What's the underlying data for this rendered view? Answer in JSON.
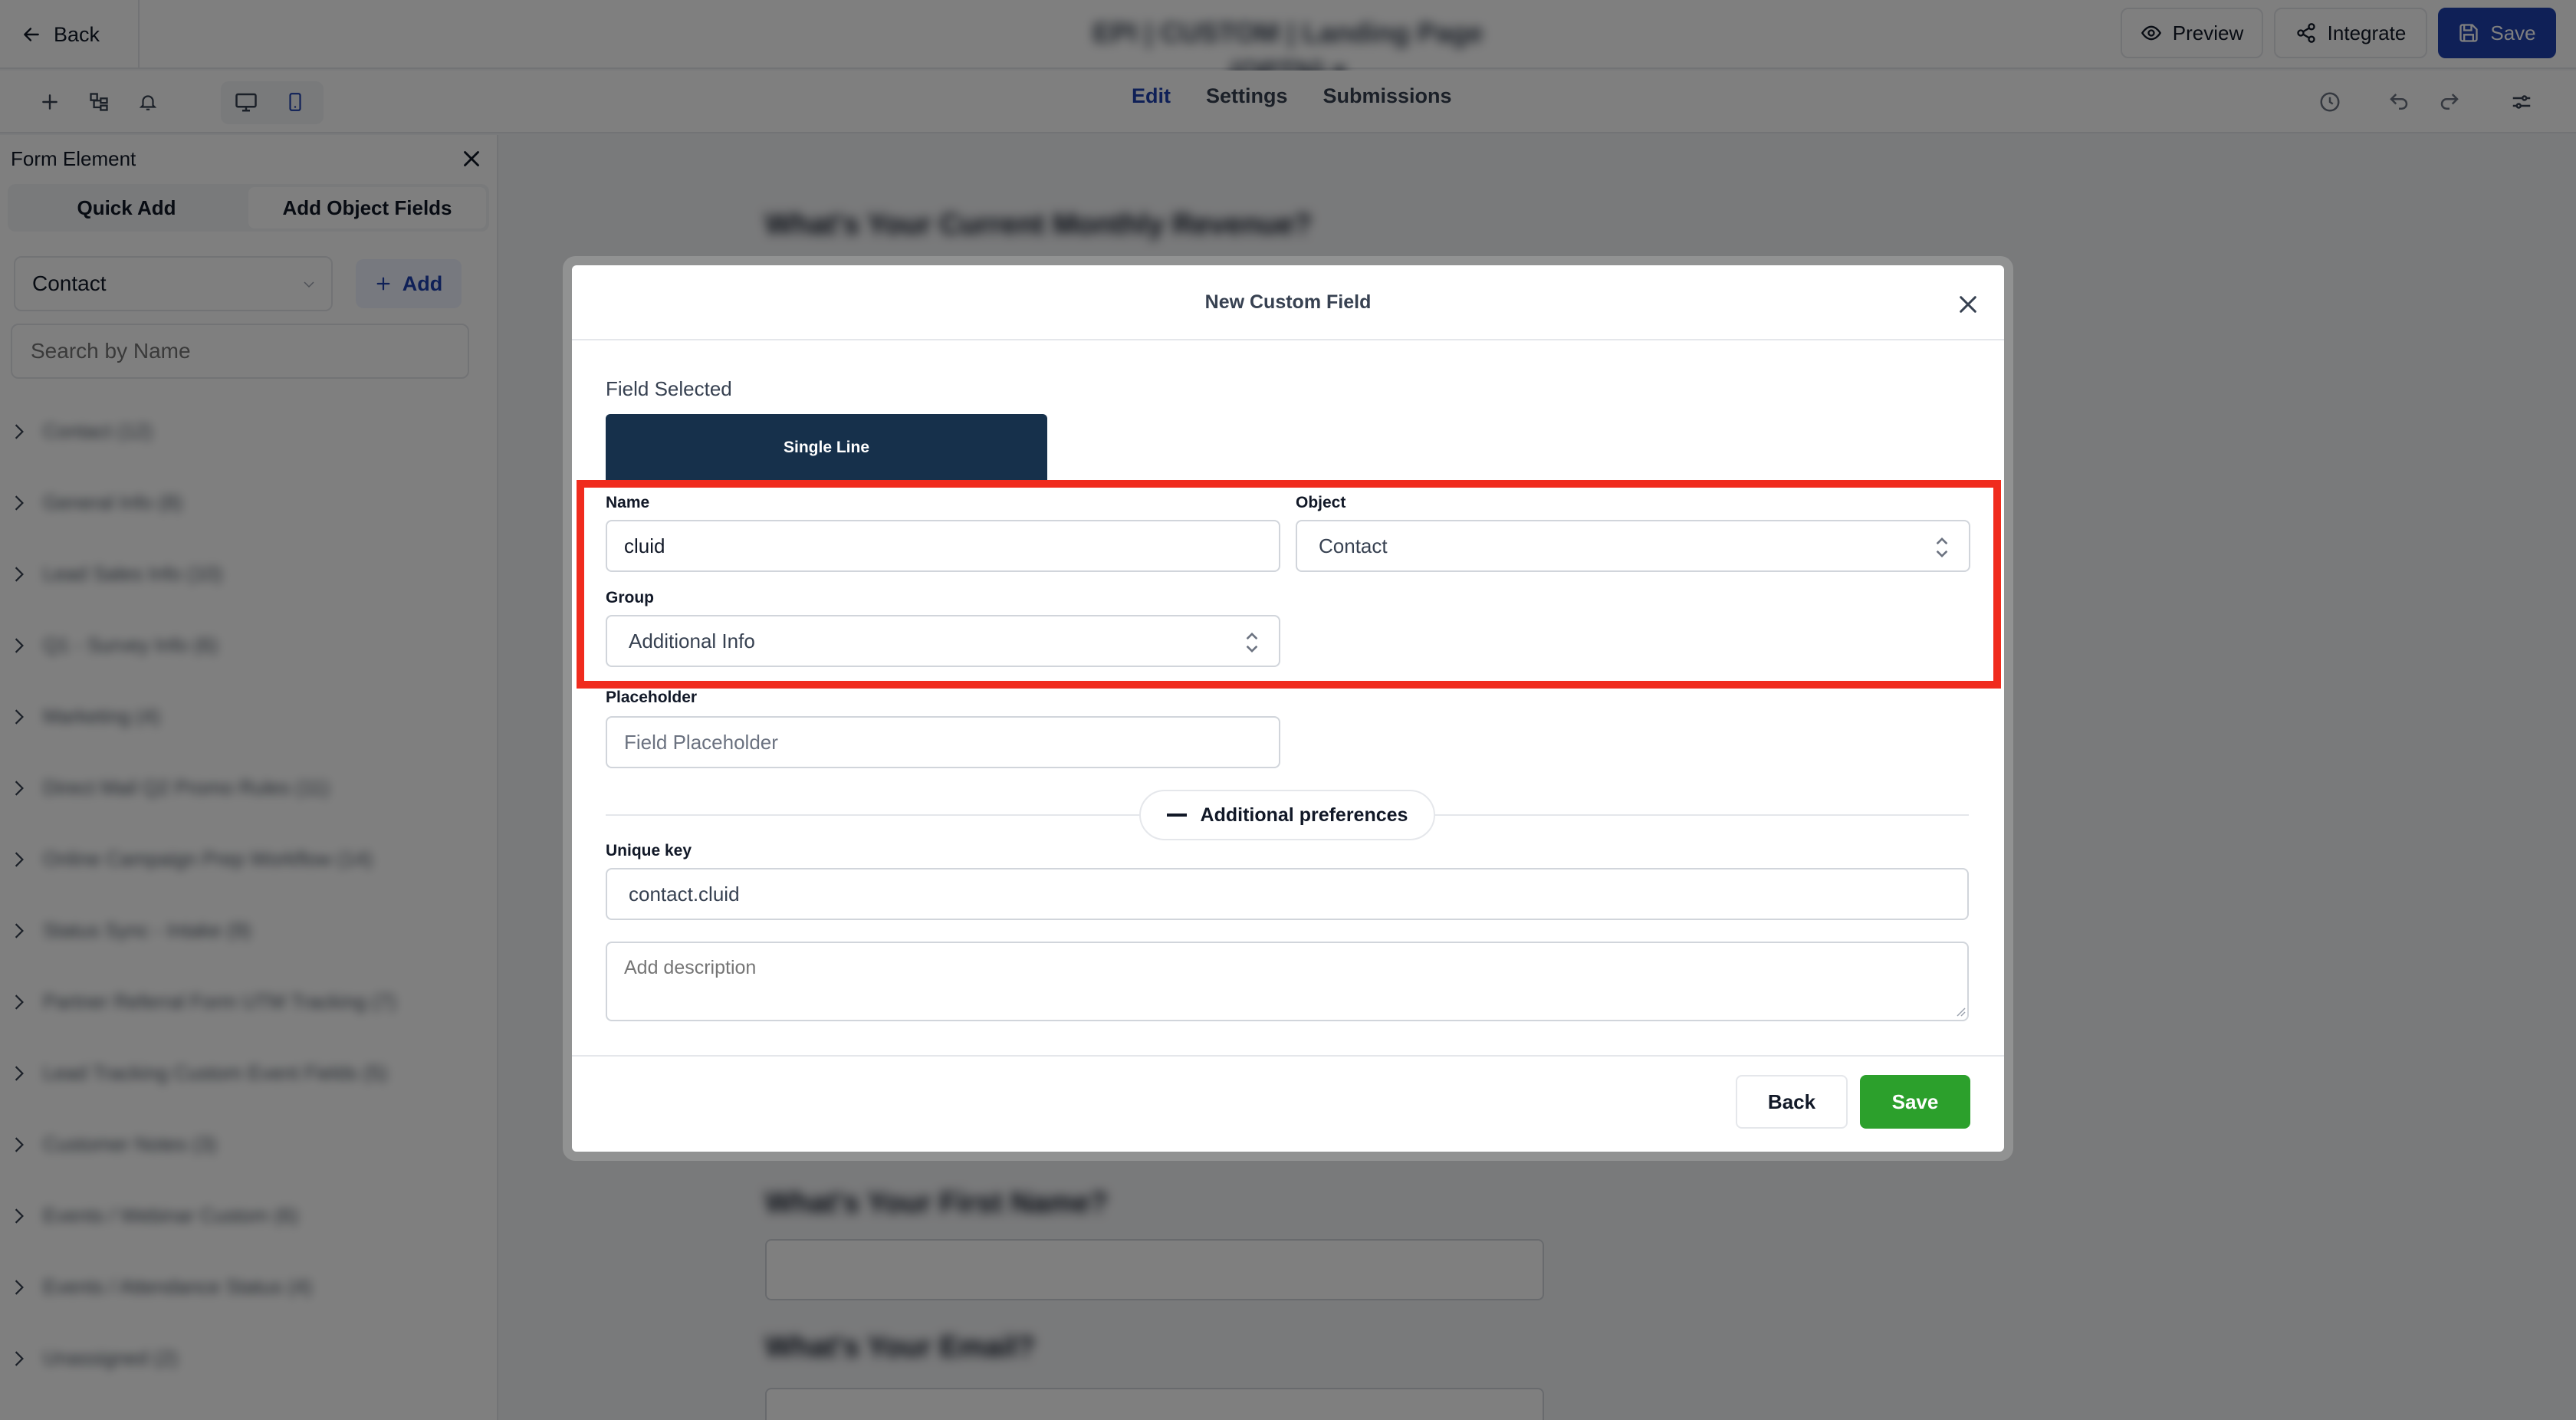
{
  "topbar": {
    "back_label": "Back",
    "form_title": "EPI | CUSTOM | Landing Page (OPTN) ▾",
    "preview_label": "Preview",
    "integrate_label": "Integrate",
    "save_label": "Save"
  },
  "editor_tabs": [
    "Edit",
    "Settings",
    "Submissions"
  ],
  "sidebar": {
    "title": "Form Element",
    "tabs": [
      "Quick Add",
      "Add Object Fields"
    ],
    "object_select": "Contact",
    "add_label": "Add",
    "search_placeholder": "Search by Name",
    "groups": [
      "Contact (12)",
      "General Info (8)",
      "Lead Sales Info (10)",
      "Q1 - Survey Info (6)",
      "Marketing (4)",
      "Direct Mail Q2 Promo Rules (11)",
      "Online Campaign Prep Workflow (14)",
      "Status Sync - Intake (9)",
      "Partner Referral Form UTM Tracking (7)",
      "Lead Tracking Custom Event Fields (5)",
      "Customer Notes (3)",
      "Events / Webinar Custom (6)",
      "Events / Attendance Status (4)",
      "Unassigned (2)"
    ]
  },
  "canvas": {
    "question_1": "What's Your Current Monthly Revenue?",
    "question_2": "What's Your First Name?",
    "question_3": "What's Your Email?"
  },
  "modal": {
    "title": "New Custom Field",
    "field_selected_label": "Field Selected",
    "field_type": "Single Line",
    "name_label": "Name",
    "name_value": "cluid",
    "object_label": "Object",
    "object_value": "Contact",
    "group_label": "Group",
    "group_value": "Additional Info",
    "placeholder_label": "Placeholder",
    "placeholder_hint": "Field Placeholder",
    "additional_prefs_label": "Additional preferences",
    "unique_key_label": "Unique key",
    "unique_key_value": "contact.cluid",
    "description_placeholder": "Add description",
    "back_label": "Back",
    "save_label": "Save"
  },
  "colors": {
    "primary": "#1e40af",
    "chip": "#16304b",
    "success": "#2ca02c",
    "highlight": "#f02b1d"
  }
}
